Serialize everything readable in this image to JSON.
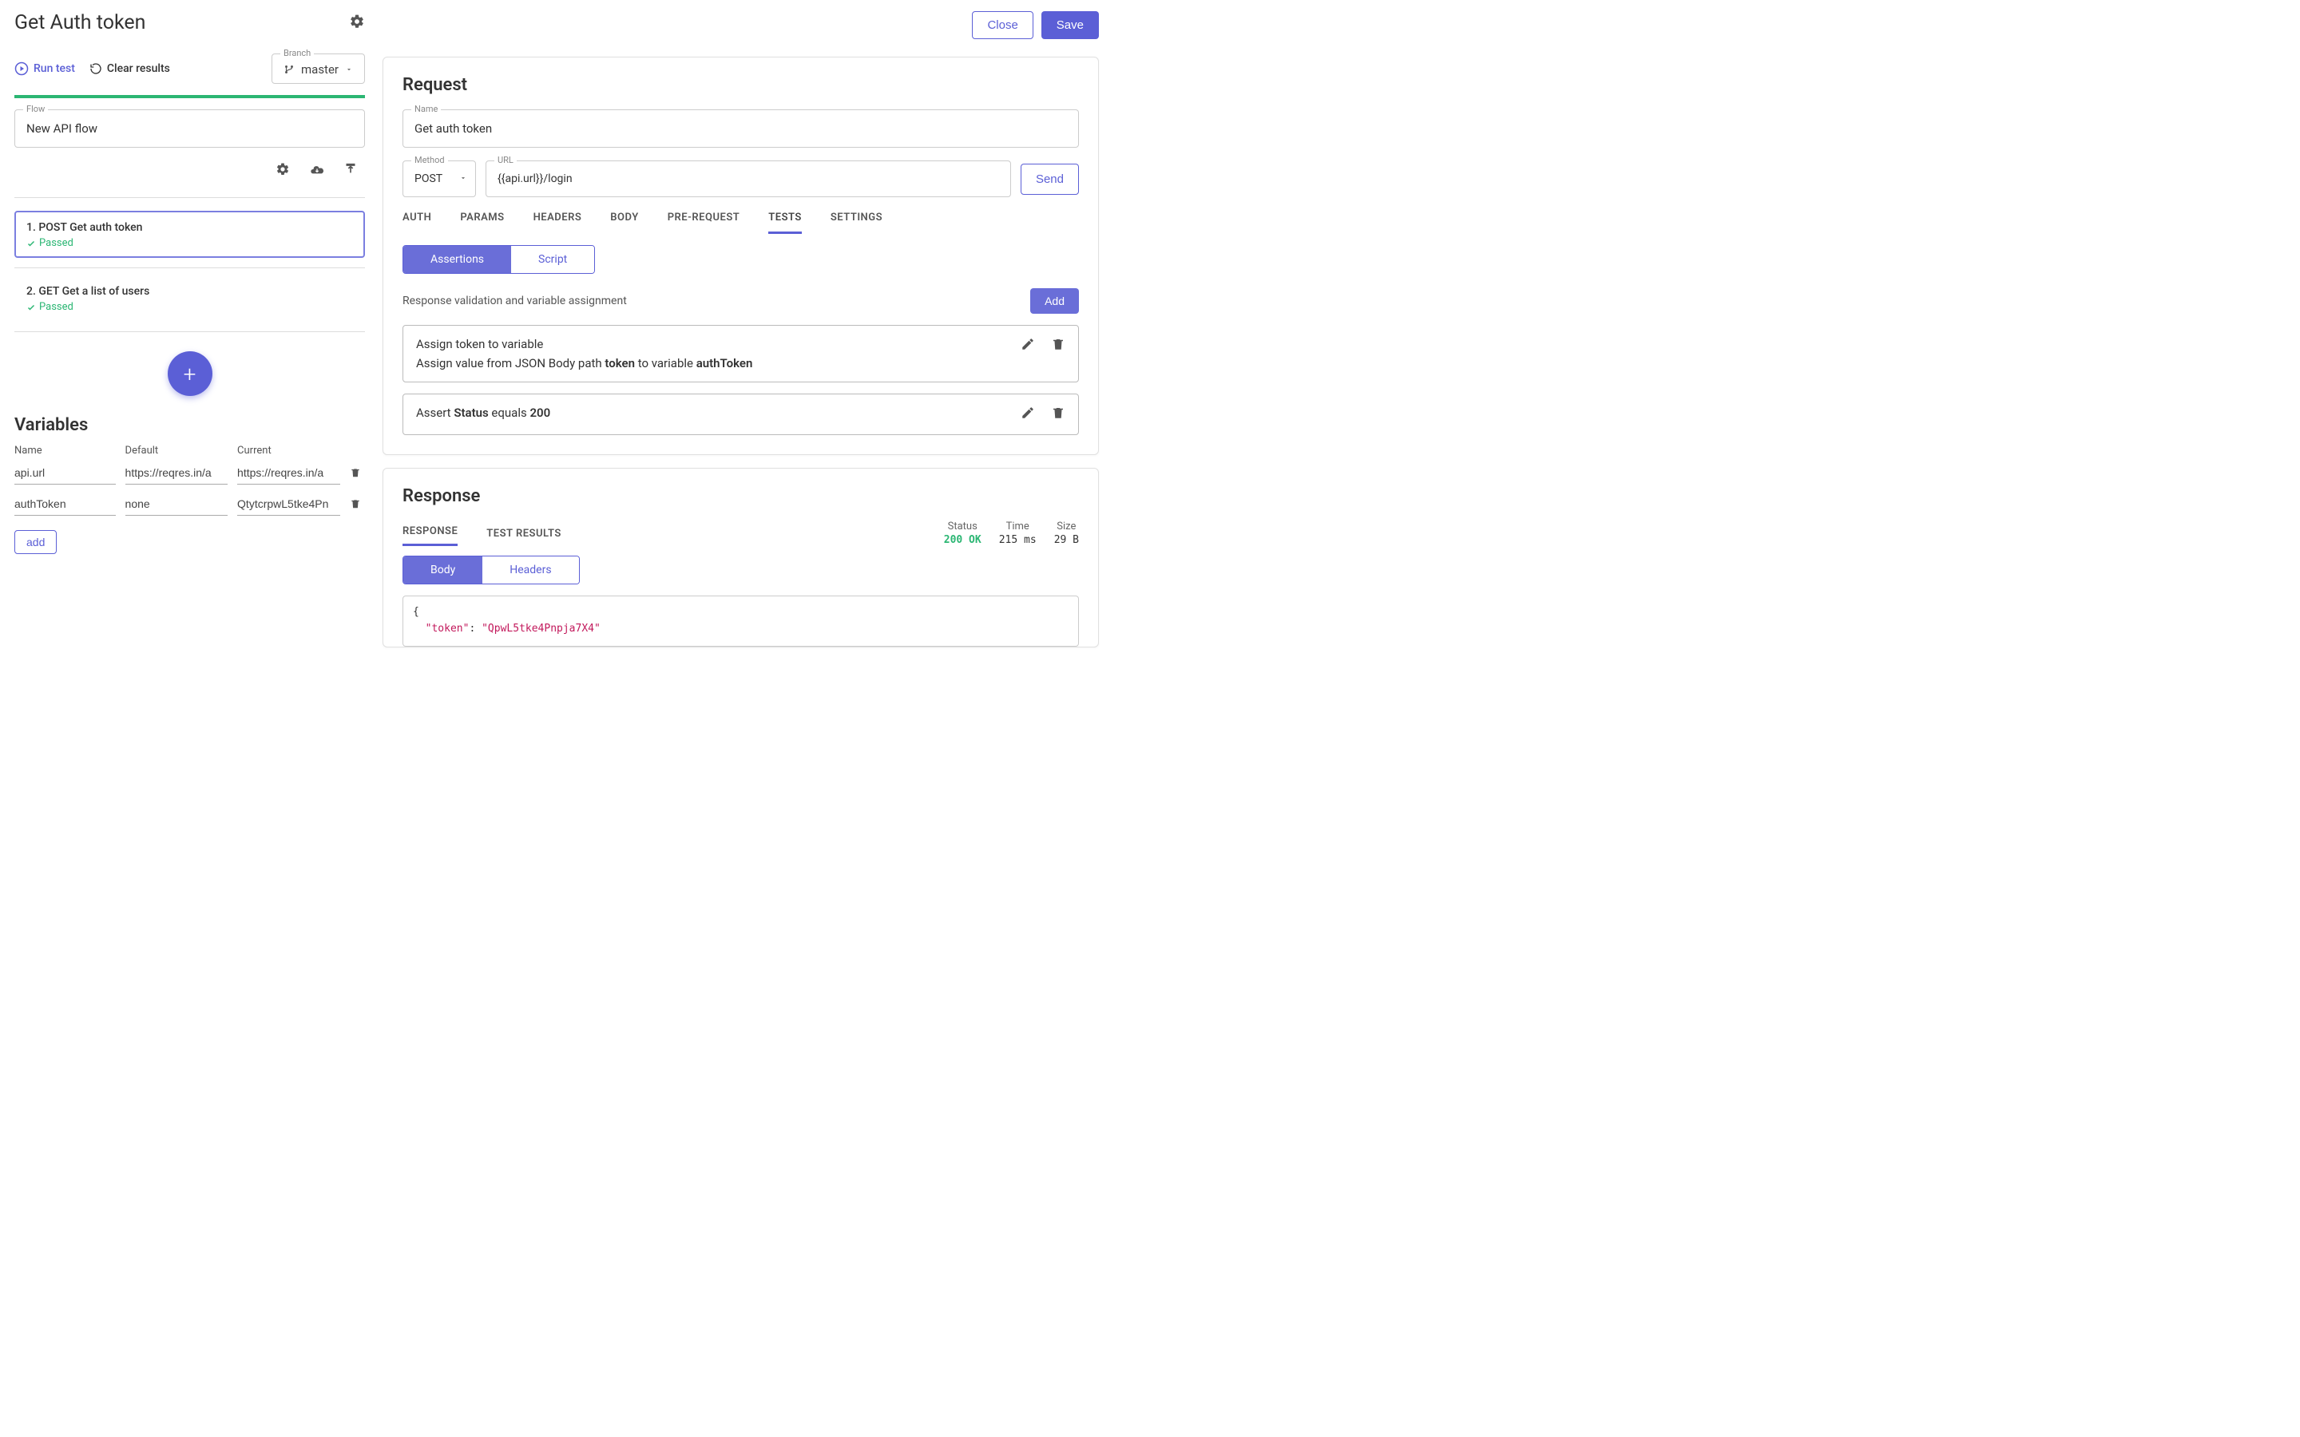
{
  "header": {
    "page_title": "Get Auth token",
    "close_label": "Close",
    "save_label": "Save"
  },
  "actions": {
    "run_test_label": "Run test",
    "clear_results_label": "Clear results",
    "branch_label": "Branch",
    "branch_value": "master"
  },
  "flow": {
    "label": "Flow",
    "value": "New API flow"
  },
  "steps": [
    {
      "title": "1. POST Get auth token",
      "status": "Passed",
      "active": true
    },
    {
      "title": "2. GET Get a list of users",
      "status": "Passed",
      "active": false
    }
  ],
  "variables": {
    "title": "Variables",
    "columns": {
      "name": "Name",
      "default": "Default",
      "current": "Current"
    },
    "rows": [
      {
        "name": "api.url",
        "default": "https://reqres.in/a",
        "current": "https://reqres.in/a"
      },
      {
        "name": "authToken",
        "default": "none",
        "current": "QtytcrpwL5tke4Pn"
      }
    ],
    "add_label": "add"
  },
  "request": {
    "title": "Request",
    "name_label": "Name",
    "name_value": "Get auth token",
    "method_label": "Method",
    "method_value": "POST",
    "url_label": "URL",
    "url_value": "{{api.url}}/login",
    "send_label": "Send",
    "tabs": [
      "AUTH",
      "PARAMS",
      "HEADERS",
      "BODY",
      "PRE-REQUEST",
      "TESTS",
      "SETTINGS"
    ],
    "active_tab": "TESTS",
    "subtab_active": "Assertions",
    "subtab_other": "Script",
    "section_text": "Response validation and variable assignment",
    "add_button": "Add",
    "assertions": [
      {
        "title": "Assign token to variable",
        "desc_prefix": "Assign value from JSON Body path ",
        "desc_bold1": "token",
        "desc_mid": " to variable ",
        "desc_bold2": "authToken"
      },
      {
        "title": "",
        "desc_prefix": "Assert ",
        "desc_bold1": "Status",
        "desc_mid": " equals ",
        "desc_bold2": "200"
      }
    ]
  },
  "response": {
    "title": "Response",
    "tab_active": "RESPONSE",
    "tab_other": "TEST RESULTS",
    "meta": {
      "status_label": "Status",
      "status_value": "200 OK",
      "time_label": "Time",
      "time_value": "215 ms",
      "size_label": "Size",
      "size_value": "29 B"
    },
    "body_tab": "Body",
    "headers_tab": "Headers",
    "code_line1": "{",
    "code_key": "\"token\"",
    "code_sep": ": ",
    "code_val": "\"QpwL5tke4Pnpja7X4\""
  }
}
